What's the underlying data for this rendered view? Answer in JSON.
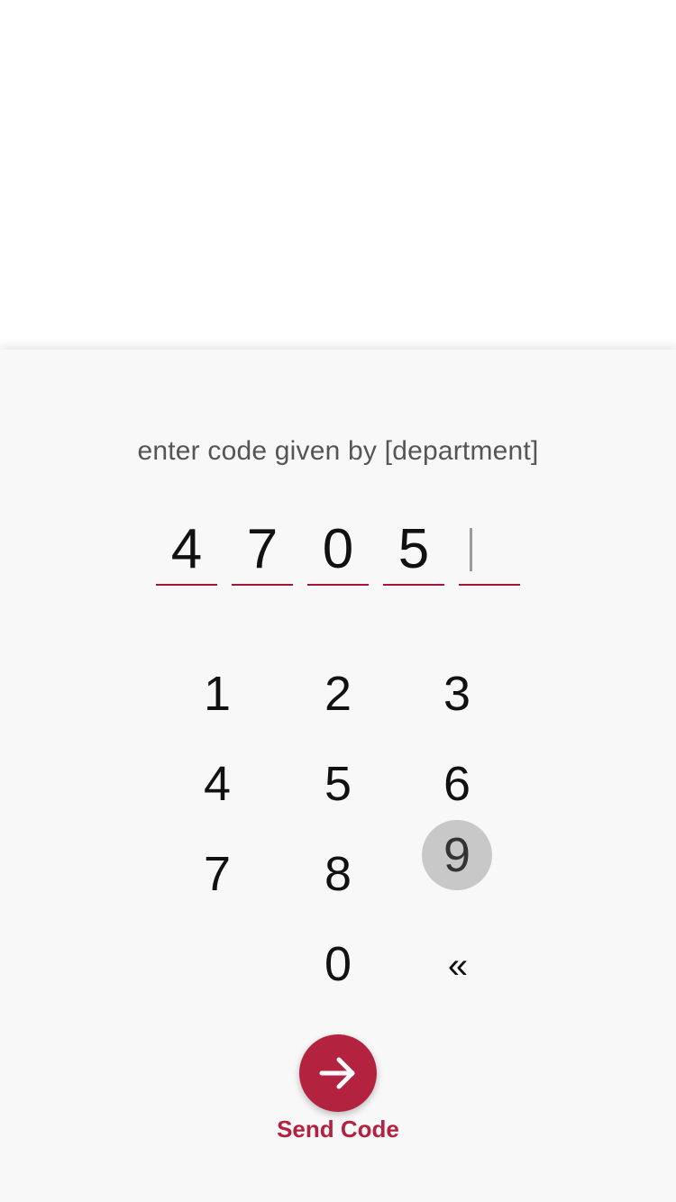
{
  "prompt": {
    "text": "enter code given by [department]"
  },
  "code": {
    "digits": [
      "4",
      "7",
      "0",
      "5",
      ""
    ]
  },
  "keypad": {
    "keys": [
      "1",
      "2",
      "3",
      "4",
      "5",
      "6",
      "7",
      "8",
      "9",
      "0",
      "«"
    ],
    "pressed_key": "9"
  },
  "send": {
    "label": "Send Code",
    "icon": "arrow-right-icon"
  },
  "colors": {
    "accent": "#b3223f",
    "underline": "#a3163a",
    "sheet_background": "#f8f8f8",
    "pressed_key_background": "#c8c8c8"
  }
}
